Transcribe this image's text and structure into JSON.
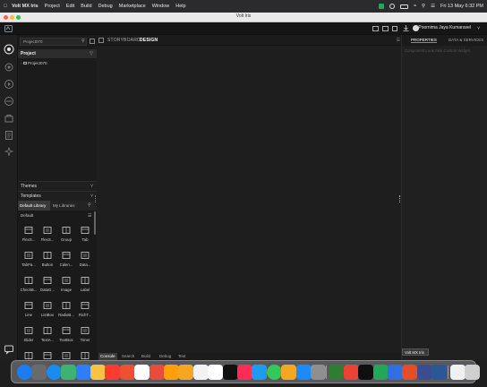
{
  "menubar": {
    "app": "Volt MX Iris",
    "items": [
      "Project",
      "Edit",
      "Build",
      "Debug",
      "Marketplace",
      "Window",
      "Help"
    ],
    "clock": "Fri 13 May  6:32 PM"
  },
  "window": {
    "title": "Volt Iris"
  },
  "toolbar": {
    "user_name": "Poornima Jaya Kumaravel"
  },
  "project_panel": {
    "search_placeholder": "Project070",
    "header": "Project",
    "tree_item": "Project070"
  },
  "accordion": {
    "themes": "Themes",
    "templates": "Templates"
  },
  "library": {
    "tabs": [
      "Default Library",
      "My Libraries"
    ],
    "section": "Default",
    "widgets": [
      {
        "label": "FlexS...",
        "icon": "flex-scroll-icon"
      },
      {
        "label": "FlexS...",
        "icon": "flex-scroll-horizontal-icon"
      },
      {
        "label": "Group",
        "icon": "group-icon"
      },
      {
        "label": "Tab",
        "icon": "tab-icon"
      },
      {
        "label": "TabPa...",
        "icon": "tab-pane-icon"
      },
      {
        "label": "Button",
        "icon": "button-icon"
      },
      {
        "label": "Calen...",
        "icon": "calendar-icon"
      },
      {
        "label": "Data...",
        "icon": "datagrid-icon"
      },
      {
        "label": "CheckB...",
        "icon": "checkbox-icon"
      },
      {
        "label": "DataG...",
        "icon": "data-grid-icon"
      },
      {
        "label": "Image",
        "icon": "image-icon"
      },
      {
        "label": "Label",
        "icon": "label-icon"
      },
      {
        "label": "Line",
        "icon": "line-icon"
      },
      {
        "label": "ListBox",
        "icon": "listbox-icon"
      },
      {
        "label": "RadioB...",
        "icon": "radio-button-icon"
      },
      {
        "label": "RichT...",
        "icon": "richtext-icon"
      },
      {
        "label": "Slider",
        "icon": "slider-icon"
      },
      {
        "label": "TextA...",
        "icon": "text-area-icon"
      },
      {
        "label": "TextBox",
        "icon": "textbox-icon"
      },
      {
        "label": "Timer",
        "icon": "timer-icon"
      },
      {
        "label": "",
        "icon": "browser-icon"
      },
      {
        "label": "",
        "icon": "segment-icon"
      },
      {
        "label": "",
        "icon": "camera-icon"
      },
      {
        "label": "",
        "icon": "map-icon"
      }
    ]
  },
  "design": {
    "tabs": [
      "STORYBOARD",
      "DESIGN"
    ],
    "active_tab": "DESIGN",
    "bottom_tabs": [
      "Console",
      "Search",
      "Build",
      "Debug",
      "Test"
    ]
  },
  "right_panel": {
    "tabs": [
      "PROPERTIES",
      "DATA & SERVICES"
    ],
    "subtabs": "Component  Look  Skin  Custom Widget"
  },
  "tooltip": "Volt MX Iris",
  "colors": {
    "dock_icons": [
      "#1e7cf2",
      "#6a6a6a",
      "#1a8cf0",
      "#3cb371",
      "#2d7ff9",
      "#f6c344",
      "#ff3b30",
      "#f05032",
      "#ffffff",
      "#e84c3d",
      "#ff9f0a",
      "#f5a623",
      "#f2f2f2",
      "#ffffff",
      "#111111",
      "#ff2d55",
      "#1d9bf0",
      "#34c759",
      "#f5a623",
      "#1c8af8",
      "#8e8e93",
      "#2e7d32",
      "#ea4335",
      "#0f0f0f",
      "#23a55a",
      "#2f6fdf",
      "#e44d26",
      "#3b4d91",
      "#2b5797",
      "#f0f0f0",
      "#cfcfcf"
    ]
  }
}
